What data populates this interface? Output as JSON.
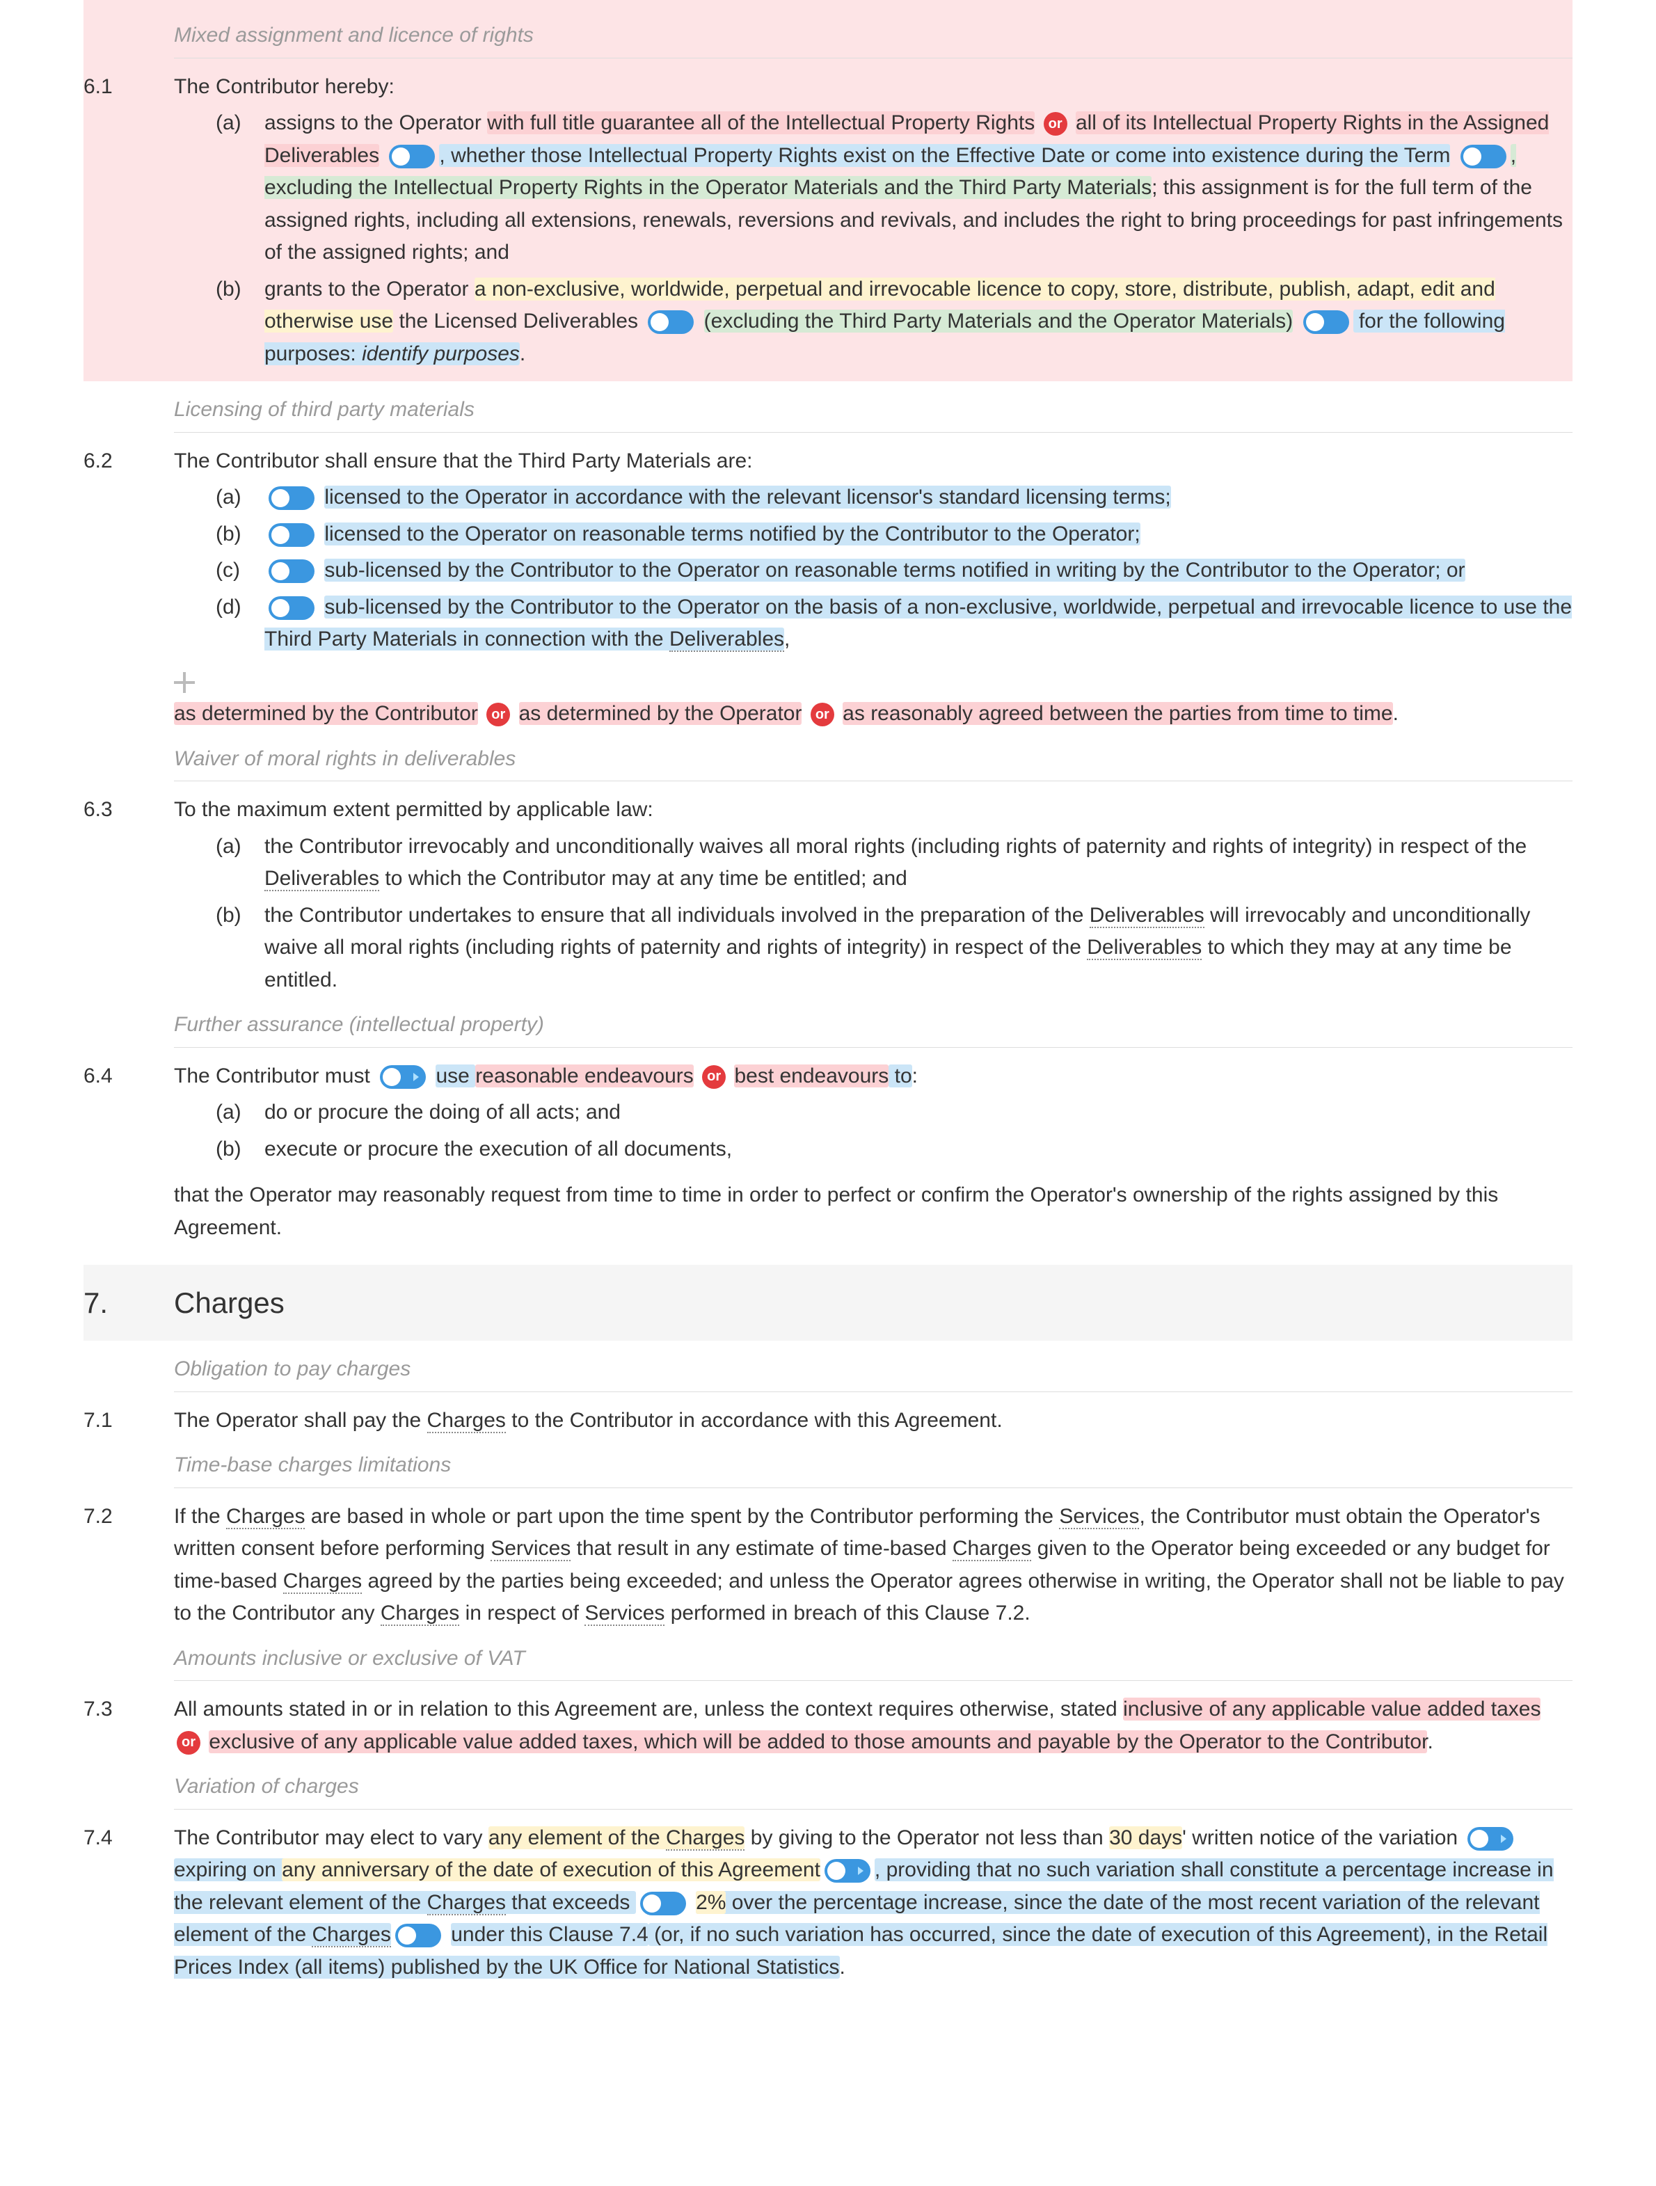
{
  "c61": {
    "subhead": "Mixed assignment and licence of rights",
    "num": "6.1",
    "intro": "The Contributor hereby:",
    "a_m": "(a)",
    "a_p1": "assigns to the Operator ",
    "a_p2_pink": "with full title guarantee all of the Intellectual Property Rights",
    "a_or1": "or",
    "a_p3_pink": "all of its Intellectual Property Rights in the Assigned Deliverables",
    "a_p4_blue": ", whether those Intellectual Property Rights exist on the Effective Date or come into existence during the Term",
    "a_p5_green": ", excluding the Intellectual Property Rights in the Operator Materials and the Third Party Materials",
    "a_p6": "; this assignment is for the full term of the assigned rights, including all extensions, renewals, reversions and revivals, and includes the right to bring proceedings for past infringements of the assigned rights; and",
    "b_m": "(b)",
    "b_p1": "grants to the Operator ",
    "b_p2_yellow": "a non-exclusive, worldwide, perpetual and irrevocable licence to copy, store, distribute, publish, adapt, edit and otherwise use",
    "b_p3": " the Licensed Deliverables ",
    "b_p4_green": "(excluding the Third Party Materials and the Operator Materials)",
    "b_p5_blue": " for the following purposes: ",
    "b_p6_it": "identify purposes",
    "b_p7": "."
  },
  "c62": {
    "subhead": "Licensing of third party materials",
    "num": "6.2",
    "intro": "The Contributor shall ensure that the Third Party Materials are:",
    "a_m": "(a)",
    "a_t": "licensed to the Operator in accordance with the relevant licensor's standard licensing terms;",
    "b_m": "(b)",
    "b_t": "licensed to the Operator on reasonable terms notified by the Contributor to the Operator;",
    "c_m": "(c)",
    "c_t": "sub-licensed by the Contributor to the Operator on reasonable terms notified in writing by the Contributor to the Operator; or",
    "d_m": "(d)",
    "d_t1": "sub-licensed by the Contributor to the Operator on the basis of a non-exclusive, worldwide, perpetual and irrevocable licence to use the Third Party Materials in connection with the ",
    "d_t2_dot": "Deliverables",
    "d_t3": ",",
    "tail1": "as determined by the Contributor",
    "or1": "or",
    "tail2": "as determined by the Operator",
    "or2": "or",
    "tail3": "as reasonably agreed between the parties from time to time",
    "tail4": "."
  },
  "c63": {
    "subhead": "Waiver of moral rights in deliverables",
    "num": "6.3",
    "intro": "To the maximum extent permitted by applicable law:",
    "a_m": "(a)",
    "a1": "the Contributor irrevocably and unconditionally waives all moral rights (including rights of paternity and rights of integrity) in respect of the ",
    "a_dot": "Deliverables",
    "a2": " to which the Contributor may at any time be entitled; and",
    "b_m": "(b)",
    "b1": "the Contributor undertakes to ensure that all individuals involved in the preparation of the ",
    "b_dot1": "Deliverables",
    "b2": " will irrevocably and unconditionally waive all moral rights (including rights of paternity and rights of integrity) in respect of the ",
    "b_dot2": "Deliverables",
    "b3": " to which they may at any time be entitled."
  },
  "c64": {
    "subhead": "Further assurance (intellectual property)",
    "num": "6.4",
    "intro1": "The Contributor must ",
    "intro2_blue": "use ",
    "intro3_pink": "reasonable endeavours",
    "or": "or",
    "intro4_pink": "best endeavours",
    "intro5_blue": " to",
    "intro6": ":",
    "a_m": "(a)",
    "a_t": "do or procure the doing of all acts; and",
    "b_m": "(b)",
    "b_t": "execute or procure the execution of all documents,",
    "trail": "that the Operator may reasonably request from time to time in order to perfect or confirm the Operator's ownership of the rights assigned by this Agreement."
  },
  "s7": {
    "num": "7.",
    "title": "Charges"
  },
  "c71": {
    "subhead": "Obligation to pay charges",
    "num": "7.1",
    "p1": "The Operator shall pay the ",
    "dot": "Charges",
    "p2": " to the Contributor in accordance with this Agreement."
  },
  "c72": {
    "subhead": "Time-base charges limitations",
    "num": "7.2",
    "p1": "If the ",
    "d1": "Charges",
    "p2": " are based in whole or part upon the time spent by the Contributor performing the ",
    "d2": "Services",
    "p3": ", the Contributor must obtain the Operator's written consent before performing ",
    "d3": "Services",
    "p4": " that result in any estimate of time-based ",
    "d4": "Charges",
    "p5": " given to the Operator being exceeded or any budget for time-based ",
    "d5": "Charges",
    "p6": " agreed by the parties being exceeded; and unless the Operator agrees otherwise in writing, the Operator shall not be liable to pay to the Contributor any ",
    "d6": "Charges",
    "p7": " in respect of ",
    "d7": "Services",
    "p8": " performed in breach of this Clause 7.2."
  },
  "c73": {
    "subhead": "Amounts inclusive or exclusive of VAT",
    "num": "7.3",
    "p1": "All amounts stated in or in relation to this Agreement are, unless the context requires otherwise, stated ",
    "pk1": "inclusive of any applicable value added taxes",
    "or": "or",
    "pk2": "exclusive of any applicable value added taxes, which will be added to those amounts and payable by the Operator to the Contributor",
    "p2": "."
  },
  "c74": {
    "subhead": "Variation of charges",
    "num": "7.4",
    "p1": "The Contributor may elect to vary ",
    "y1": "any element of the ",
    "y1d": "Charges",
    "p2": " by giving to the Operator not less than ",
    "y2": "30 days",
    "p3": "' written notice of the variation ",
    "b1a": "expiring on ",
    "b1b": "any anniversary of the date of execution of this Agreement",
    "b2a": ", providing that no such variation shall constitute a percentage increase in the relevant element of the ",
    "b2d1": "Charges",
    "b2b": " that exceeds ",
    "y3": "2%",
    "b2c": " over the percentage increase, since the date of the most recent variation of the relevant element of the ",
    "b2d2": "Charges",
    "b3": " under this Clause 7.4",
    "b4a": " (or, if no such variation has occurred, since the date of execution of this Agreement), in the Retail Prices Index (all items) published by the UK Office for National Statistics",
    "p4": "."
  }
}
